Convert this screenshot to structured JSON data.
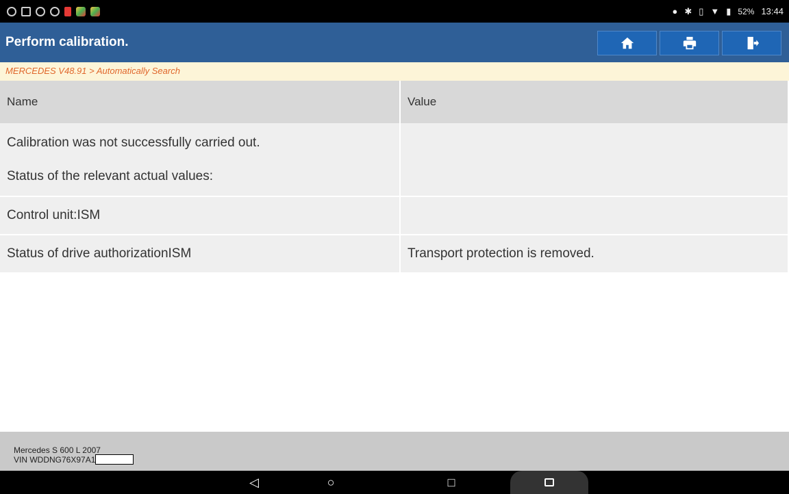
{
  "status_bar": {
    "battery": "52%",
    "time": "13:44"
  },
  "header": {
    "title": "Perform calibration.",
    "buttons": {
      "home_icon": "home-icon",
      "print_icon": "print-icon",
      "exit_icon": "exit-icon"
    }
  },
  "breadcrumb": "MERCEDES V48.91 > Automatically Search",
  "table": {
    "headers": {
      "name": "Name",
      "value": "Value"
    },
    "rows": [
      {
        "name_lines": [
          "Calibration was not successfully carried out.",
          "Status of the relevant actual values:"
        ],
        "value": ""
      },
      {
        "name": "Control unit:ISM",
        "value": ""
      },
      {
        "name": "Status of drive authorizationISM",
        "value": "Transport protection is removed."
      }
    ]
  },
  "footer": {
    "vehicle": "Mercedes S 600 L 2007",
    "vin": "VIN WDDNG76X97A1"
  },
  "colors": {
    "header_bg": "#2f5f97",
    "button_bg": "#1f66b5",
    "breadcrumb_bg": "#fdf5d8",
    "breadcrumb_text": "#e0662b"
  }
}
